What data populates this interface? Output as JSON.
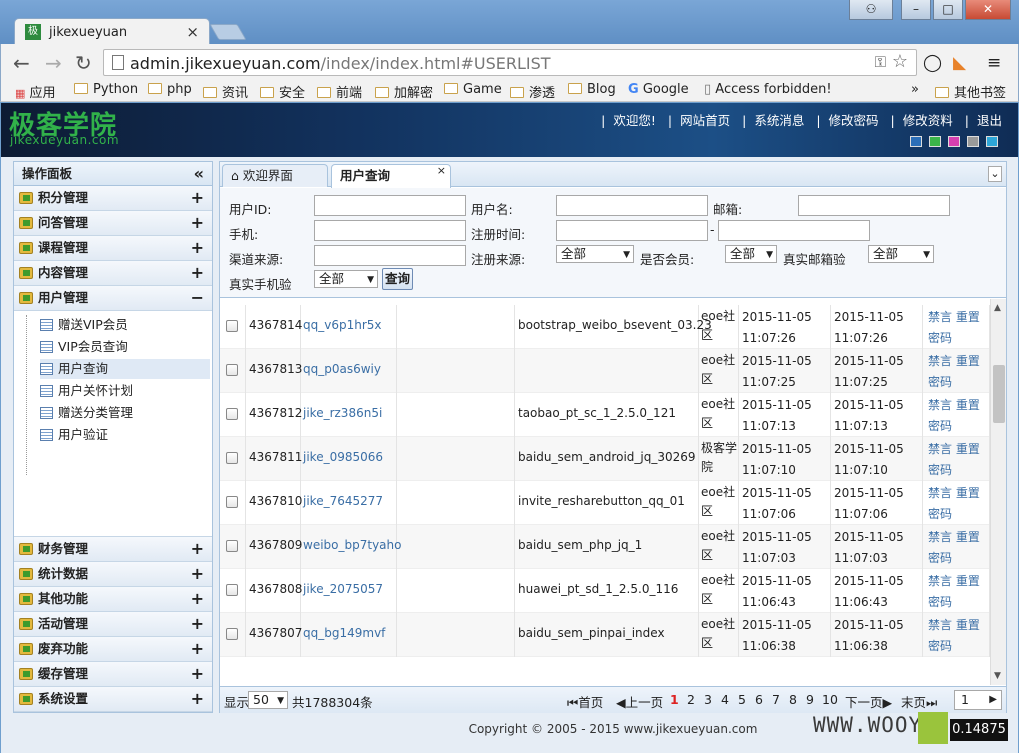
{
  "browser": {
    "tab_title": "jikexueyuan",
    "url_host": "admin.jikexueyuan.com",
    "url_path": "/index/index.html#USERLIST",
    "bookmarks": [
      "应用",
      "Python",
      "php",
      "资讯",
      "安全",
      "前端",
      "加解密",
      "Game",
      "渗透",
      "Blog",
      "Google",
      "Access forbidden!"
    ],
    "other_bookmarks": "其他书签"
  },
  "header": {
    "logo": "极客学院",
    "logo_sub": "jikexueyuan.com",
    "nav": [
      "欢迎您!",
      "网站首页",
      "系统消息",
      "修改密码",
      "修改资料",
      "退出"
    ],
    "swatch_colors": [
      "#2c6fb8",
      "#3bb54a",
      "#d63fb0",
      "#9a9a9a",
      "#2ea6d8"
    ]
  },
  "sidebar": {
    "title": "操作面板",
    "groups_top": [
      "积分管理",
      "问答管理",
      "课程管理",
      "内容管理",
      "用户管理"
    ],
    "sub_items": [
      "赠送VIP会员",
      "VIP会员查询",
      "用户查询",
      "用户关怀计划",
      "赠送分类管理",
      "用户验证"
    ],
    "groups_bottom": [
      "财务管理",
      "统计数据",
      "其他功能",
      "活动管理",
      "废弃功能",
      "缓存管理",
      "系统设置"
    ]
  },
  "tabs": [
    "欢迎界面",
    "用户查询"
  ],
  "form": {
    "user_id": "用户ID:",
    "username": "用户名:",
    "email": "邮箱:",
    "phone": "手机:",
    "reg_time": "注册时间:",
    "channel": "渠道来源:",
    "reg_source": "注册来源:",
    "reg_source_val": "全部",
    "is_member": "是否会员:",
    "is_member_val": "全部",
    "real_email": "真实邮箱验",
    "real_email_val": "全部",
    "real_phone": "真实手机验",
    "real_phone_val": "全部",
    "query": "查询",
    "dash": "-"
  },
  "rows": [
    {
      "id": "4367814",
      "user": "qq_v6p1hr5x",
      "src": "bootstrap_weibo_bsevent_03.23",
      "site1": "eoe社",
      "site2": "区",
      "d1": "2015-11-05",
      "t1": "11:07:26",
      "d2": "2015-11-05",
      "t2": "11:07:26",
      "a1": "禁言",
      "a2": "重置",
      "a3": "密码"
    },
    {
      "id": "4367813",
      "user": "qq_p0as6wiy",
      "src": "",
      "site1": "eoe社",
      "site2": "区",
      "d1": "2015-11-05",
      "t1": "11:07:25",
      "d2": "2015-11-05",
      "t2": "11:07:25",
      "a1": "禁言",
      "a2": "重置",
      "a3": "密码"
    },
    {
      "id": "4367812",
      "user": "jike_rz386n5i",
      "src": "taobao_pt_sc_1_2.5.0_121",
      "site1": "eoe社",
      "site2": "区",
      "d1": "2015-11-05",
      "t1": "11:07:13",
      "d2": "2015-11-05",
      "t2": "11:07:13",
      "a1": "禁言",
      "a2": "重置",
      "a3": "密码"
    },
    {
      "id": "4367811",
      "user": "jike_0985066",
      "src": "baidu_sem_android_jq_30269",
      "site1": "极客学",
      "site2": "院",
      "d1": "2015-11-05",
      "t1": "11:07:10",
      "d2": "2015-11-05",
      "t2": "11:07:10",
      "a1": "禁言",
      "a2": "重置",
      "a3": "密码"
    },
    {
      "id": "4367810",
      "user": "jike_7645277",
      "src": "invite_resharebutton_qq_01",
      "site1": "eoe社",
      "site2": "区",
      "d1": "2015-11-05",
      "t1": "11:07:06",
      "d2": "2015-11-05",
      "t2": "11:07:06",
      "a1": "禁言",
      "a2": "重置",
      "a3": "密码"
    },
    {
      "id": "4367809",
      "user": "weibo_bp7tyaho",
      "src": "baidu_sem_php_jq_1",
      "site1": "eoe社",
      "site2": "区",
      "d1": "2015-11-05",
      "t1": "11:07:03",
      "d2": "2015-11-05",
      "t2": "11:07:03",
      "a1": "禁言",
      "a2": "重置",
      "a3": "密码"
    },
    {
      "id": "4367808",
      "user": "jike_2075057",
      "src": "huawei_pt_sd_1_2.5.0_116",
      "site1": "eoe社",
      "site2": "区",
      "d1": "2015-11-05",
      "t1": "11:06:43",
      "d2": "2015-11-05",
      "t2": "11:06:43",
      "a1": "禁言",
      "a2": "重置",
      "a3": "密码"
    },
    {
      "id": "4367807",
      "user": "qq_bg149mvf",
      "src": "baidu_sem_pinpai_index",
      "site1": "eoe社",
      "site2": "区",
      "d1": "2015-11-05",
      "t1": "11:06:38",
      "d2": "2015-11-05",
      "t2": "11:06:38",
      "a1": "禁言",
      "a2": "重置",
      "a3": "密码"
    }
  ],
  "pager": {
    "show": "显示",
    "per_page": "50",
    "total": "共1788304条",
    "first": "首页",
    "prev": "上一页",
    "pages": [
      "1",
      "2",
      "3",
      "4",
      "5",
      "6",
      "7",
      "8",
      "9",
      "10"
    ],
    "next": "下一页",
    "last": "末页",
    "page_input": "1"
  },
  "footer": "Copyright © 2005 - 2015 www.jikexueyuan.com",
  "watermark": {
    "text": "WWW.WOOYU",
    "value": "0.14875"
  }
}
